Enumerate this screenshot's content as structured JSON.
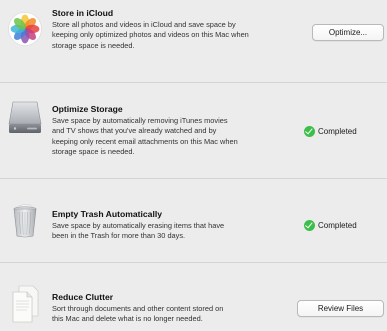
{
  "items": [
    {
      "icon": "photos-icon",
      "title": "Store in iCloud",
      "description_lines": [
        "Store all photos and videos in iCloud and save space by",
        "keeping only optimized photos and videos on this Mac when",
        "storage space is needed."
      ],
      "action_label": "Optimize..."
    },
    {
      "icon": "hard-drive-icon",
      "title": "Optimize Storage",
      "description_lines": [
        "Save space by automatically removing iTunes movies",
        "and TV shows that you've already watched and by",
        "keeping only recent email attachments on this Mac when",
        "storage space is needed."
      ],
      "status_label": "Completed"
    },
    {
      "icon": "trash-icon",
      "title": "Empty Trash Automatically",
      "description_lines": [
        "Save space by automatically erasing items that have",
        "been in the Trash for more than 30 days."
      ],
      "status_label": "Completed"
    },
    {
      "icon": "documents-icon",
      "title": "Reduce Clutter",
      "description_lines": [
        "Sort through documents and other content stored on",
        "this Mac and delete what is no longer needed."
      ],
      "action_label": "Review Files"
    }
  ],
  "colors": {
    "background": "#ececec",
    "completed_check": "#3bbf4a",
    "separator": "#d4d4d4"
  }
}
